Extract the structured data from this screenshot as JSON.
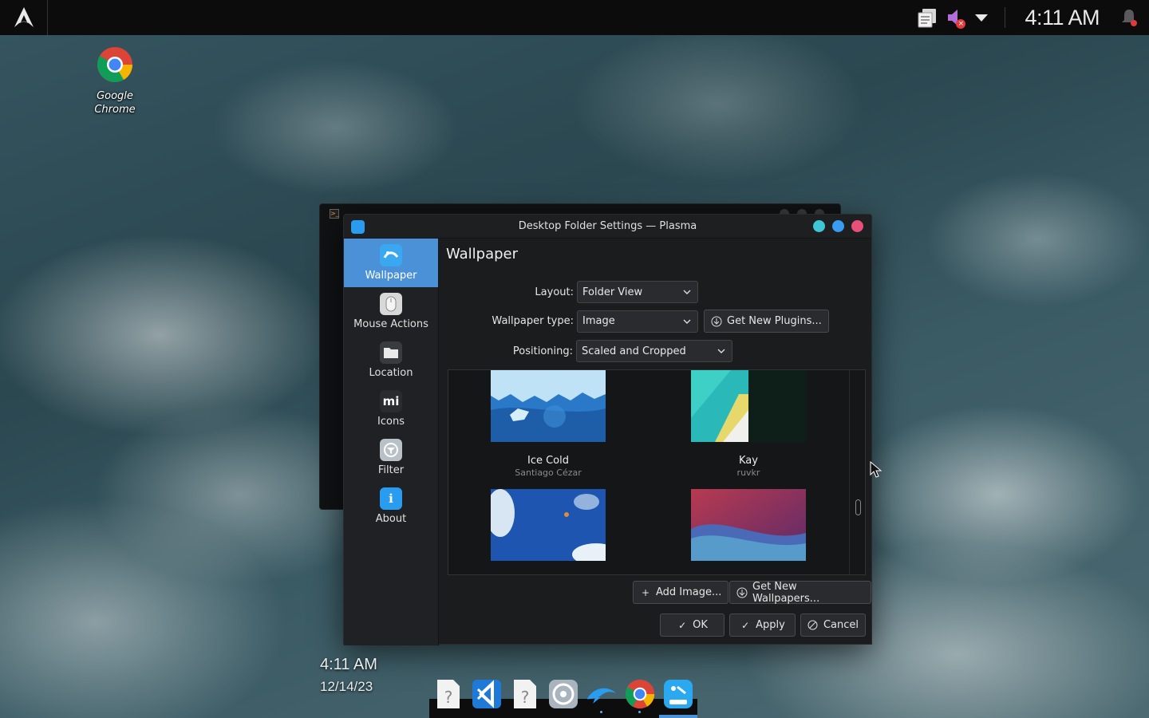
{
  "panel": {
    "clock": "4:11 AM"
  },
  "desktop": {
    "icon_label_line1": "Google",
    "icon_label_line2": "Chrome",
    "clock_time": "4:11 AM",
    "clock_date": "12/14/23"
  },
  "dialog": {
    "title": "Desktop Folder Settings — Plasma",
    "heading": "Wallpaper",
    "sidebar": [
      {
        "label": "Wallpaper",
        "icon": "wallpaper-icon",
        "active": true
      },
      {
        "label": "Mouse Actions",
        "icon": "mouse-icon",
        "active": false
      },
      {
        "label": "Location",
        "icon": "folder-icon",
        "active": false
      },
      {
        "label": "Icons",
        "icon": "icons-icon",
        "active": false
      },
      {
        "label": "Filter",
        "icon": "filter-icon",
        "active": false
      },
      {
        "label": "About",
        "icon": "info-icon",
        "active": false
      }
    ],
    "layout_label": "Layout:",
    "layout_value": "Folder View",
    "wallpaper_type_label": "Wallpaper type:",
    "wallpaper_type_value": "Image",
    "get_plugins": "Get New Plugins...",
    "positioning_label": "Positioning:",
    "positioning_value": "Scaled and Cropped",
    "wallpapers": [
      {
        "name": "Ice Cold",
        "author": "Santiago Cézar"
      },
      {
        "name": "Kay",
        "author": "ruvkr"
      },
      {
        "name": "",
        "author": ""
      },
      {
        "name": "",
        "author": ""
      }
    ],
    "add_image": "Add Image...",
    "get_wallpapers": "Get New Wallpapers...",
    "ok": "OK",
    "apply": "Apply",
    "cancel": "Cancel"
  },
  "colors": {
    "accent": "#4a91d8",
    "close": "#e8507a",
    "maximize": "#3a9cf0",
    "minimize": "#3ec6d6"
  }
}
